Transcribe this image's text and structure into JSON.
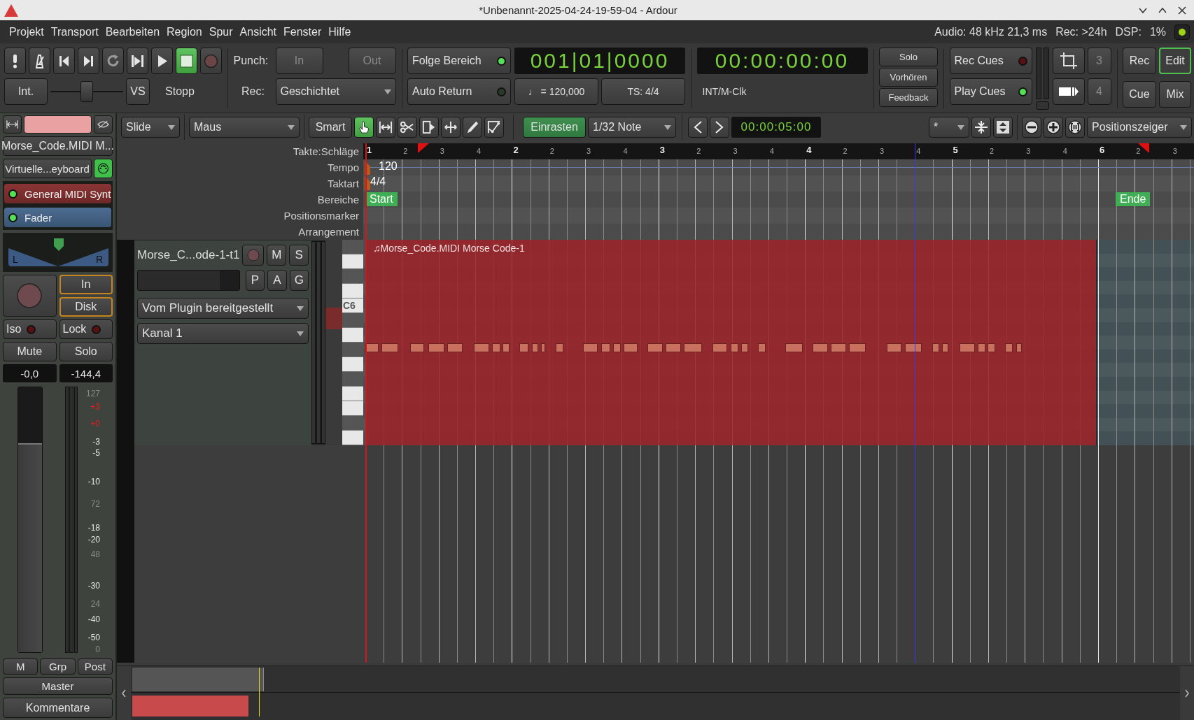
{
  "window": {
    "title": "*Unbenannt-2025-04-24-19-59-04 - Ardour"
  },
  "menu": [
    "Projekt",
    "Transport",
    "Bearbeiten",
    "Region",
    "Spur",
    "Ansicht",
    "Fenster",
    "Hilfe"
  ],
  "status": {
    "audio": "Audio: 48 kHz 21,3 ms",
    "rec": "Rec: >24h",
    "dsp_label": "DSP:",
    "dsp": "1%"
  },
  "transport": {
    "buttons": [
      {
        "kind": "alert",
        "selected": false
      },
      {
        "kind": "metronome",
        "selected": false
      },
      {
        "kind": "start",
        "selected": false
      },
      {
        "kind": "end",
        "selected": false
      },
      {
        "kind": "loop",
        "selected": false
      },
      {
        "kind": "range",
        "selected": false
      },
      {
        "kind": "play",
        "selected": false
      },
      {
        "kind": "stop",
        "selected": true
      },
      {
        "kind": "record",
        "selected": false
      }
    ],
    "sync": "Int.",
    "shuttle": {
      "level": 0.5
    },
    "vs": "VS",
    "state": "Stopp",
    "punch_label": "Punch:",
    "punch_in": "In",
    "punch_out": "Out",
    "rec_label": "Rec:",
    "rec_mode": "Geschichtet",
    "toggles": [
      {
        "label": "Folge Bereich",
        "on": true
      },
      {
        "label": "Auto Return",
        "on": false
      }
    ],
    "bbt_clock": "001|01|0000",
    "tempo": "♩ = 120,000",
    "meter": "TS: 4/4",
    "timecode_clock": "00:00:00:00",
    "sync_source": "INT/M-Clk",
    "monitor": [
      "Solo",
      "Vorhören",
      "Feedback"
    ],
    "cues": [
      {
        "label": "Rec Cues",
        "on": false
      },
      {
        "label": "Play Cues",
        "on": true
      }
    ],
    "slots": [
      "3",
      "4"
    ],
    "windows": [
      {
        "label": "Rec",
        "selected": false
      },
      {
        "label": "Edit",
        "selected": true
      },
      {
        "label": "Cue",
        "selected": false
      },
      {
        "label": "Mix",
        "selected": false
      }
    ]
  },
  "edit_toolbar": {
    "edit_mode": "Slide",
    "edit_point_mode": "Maus",
    "smart": "Smart",
    "tools": [
      {
        "kind": "grab",
        "selected": true
      },
      {
        "kind": "range",
        "selected": false
      },
      {
        "kind": "cut",
        "selected": false
      },
      {
        "kind": "stretch",
        "selected": false
      },
      {
        "kind": "move",
        "selected": false
      },
      {
        "kind": "draw",
        "selected": false
      },
      {
        "kind": "automation",
        "selected": false
      }
    ],
    "snap": {
      "label": "Einrasten",
      "on": true
    },
    "grid": "1/32 Note",
    "nudge_clock": "00:00:05:00",
    "zoom_focus": "*",
    "position": "Positionszeiger"
  },
  "strip": {
    "name": "Morse_Code.MIDI M...",
    "input": "Virtuelle...eyboard",
    "processors": [
      {
        "label": "General MIDI Synt",
        "kind": "plugin",
        "active": true
      },
      {
        "label": "Fader",
        "kind": "fader",
        "active": true
      }
    ],
    "pan": {
      "left": "L",
      "right": "R",
      "level": 0.5
    },
    "monitor": [
      "In",
      "Disk"
    ],
    "iso": {
      "label": "Iso",
      "on": false
    },
    "lock": {
      "label": "Lock",
      "on": false
    },
    "mute": "Mute",
    "solo": "Solo",
    "gain": "-0,0",
    "peak": "-144,4",
    "fader": {
      "level": 0.79
    },
    "scale": [
      {
        "label": "127",
        "kind": "midi"
      },
      {
        "label": "+3",
        "kind": "hot"
      },
      {
        "label": "+0",
        "kind": "hot"
      },
      {
        "label": "-3",
        "kind": "db"
      },
      {
        "label": "-5",
        "kind": "db"
      },
      {
        "label": "-10",
        "kind": "db"
      },
      {
        "label": "72",
        "kind": "midi"
      },
      {
        "label": "-18",
        "kind": "db"
      },
      {
        "label": "-20",
        "kind": "db"
      },
      {
        "label": "48",
        "kind": "midi"
      },
      {
        "label": "-30",
        "kind": "db"
      },
      {
        "label": "24",
        "kind": "midi"
      },
      {
        "label": "-40",
        "kind": "db"
      },
      {
        "label": "-50",
        "kind": "db"
      },
      {
        "label": "0",
        "kind": "midi"
      }
    ],
    "bottom": [
      "M",
      "Grp",
      "Post"
    ],
    "master": "Master",
    "comments": "Kommentare"
  },
  "rulers": {
    "labels": [
      "Takte:Schläge",
      "Tempo",
      "Taktart",
      "Bereiche",
      "Positionsmarker",
      "Arrangement"
    ],
    "beats": [
      "1",
      "2",
      "3",
      "4",
      "2",
      "2",
      "3",
      "4",
      "3",
      "2",
      "3",
      "4",
      "4",
      "2",
      "3",
      "4",
      "5",
      "2",
      "3",
      "4",
      "6",
      "2",
      "3"
    ],
    "tempo": "120",
    "meter": "4/4",
    "markers": [
      {
        "label": "Start",
        "kind": "start"
      },
      {
        "label": "Ende",
        "kind": "end"
      }
    ]
  },
  "track": {
    "name": "Morse_C...ode-1-t1",
    "buttons": [
      "M",
      "S",
      "P",
      "A",
      "G"
    ],
    "channel_mode": "Vom Plugin bereitgestellt",
    "channel": "Kanal 1",
    "key_label": "C6",
    "region": "♫Morse_Code.MIDI Morse Code-1"
  }
}
